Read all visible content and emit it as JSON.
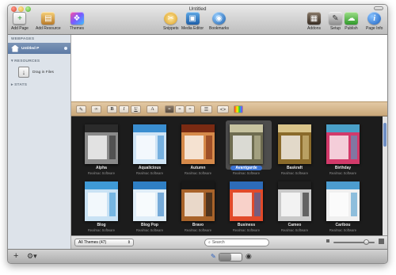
{
  "window": {
    "title": "Untitled"
  },
  "toolbar": {
    "add_page": "Add Page",
    "add_resource": "Add Resource",
    "themes": "Themes",
    "snippets": "Snippets",
    "media_editor": "Media Editor",
    "bookmarks": "Bookmarks",
    "addons": "Addons",
    "setup": "Setup",
    "publish": "Publish",
    "page_info": "Page Info"
  },
  "sidebar": {
    "webpages_header": "WEBPAGES",
    "page_name": "Untitled P",
    "resources_header": "RESOURCES",
    "drag_files": "Drag in Files",
    "stats_header": "STATS"
  },
  "format_bar": {
    "bold": "B",
    "italic": "I",
    "underline": "U",
    "font": "A",
    "code": "<>"
  },
  "themes": [
    {
      "name": "Alpha",
      "vendor": "Realmac Software",
      "color": "#2b2b2b",
      "accent": "#8a8a8a"
    },
    {
      "name": "Aqualicious",
      "vendor": "Realmac Software",
      "color": "#3a8ed0",
      "accent": "#cfe4f5"
    },
    {
      "name": "Autumn",
      "vendor": "Realmac Software",
      "color": "#7a2a12",
      "accent": "#d68a4a"
    },
    {
      "name": "Avantgarde",
      "vendor": "Realmac Software",
      "color": "#c7c3a0",
      "accent": "#6e6c50",
      "selected": true
    },
    {
      "name": "Baskraft",
      "vendor": "Realmac Software",
      "color": "#d9c48a",
      "accent": "#8a6a2a"
    },
    {
      "name": "Birthday",
      "vendor": "Realmac Software",
      "color": "#4aa0c8",
      "accent": "#d23a6a"
    },
    {
      "name": "Blog",
      "vendor": "Realmac Software",
      "color": "#3f9ad6",
      "accent": "#c9e2f4"
    },
    {
      "name": "Blog Pop",
      "vendor": "Realmac Software",
      "color": "#2f7fc4",
      "accent": "#e0eef8"
    },
    {
      "name": "Bravo",
      "vendor": "Realmac Software",
      "color": "#181818",
      "accent": "#a8632a"
    },
    {
      "name": "Business",
      "vendor": "Realmac Software",
      "color": "#2d6bb8",
      "accent": "#e14a2a"
    },
    {
      "name": "Cameo",
      "vendor": "Realmac Software",
      "color": "#1f1f1f",
      "accent": "#c9c9c9"
    },
    {
      "name": "Caribou",
      "vendor": "Realmac Software",
      "color": "#4c9ccf",
      "accent": "#f0f0f0"
    }
  ],
  "bottom": {
    "filter_label": "All Themes (47)",
    "search_placeholder": "Search"
  }
}
